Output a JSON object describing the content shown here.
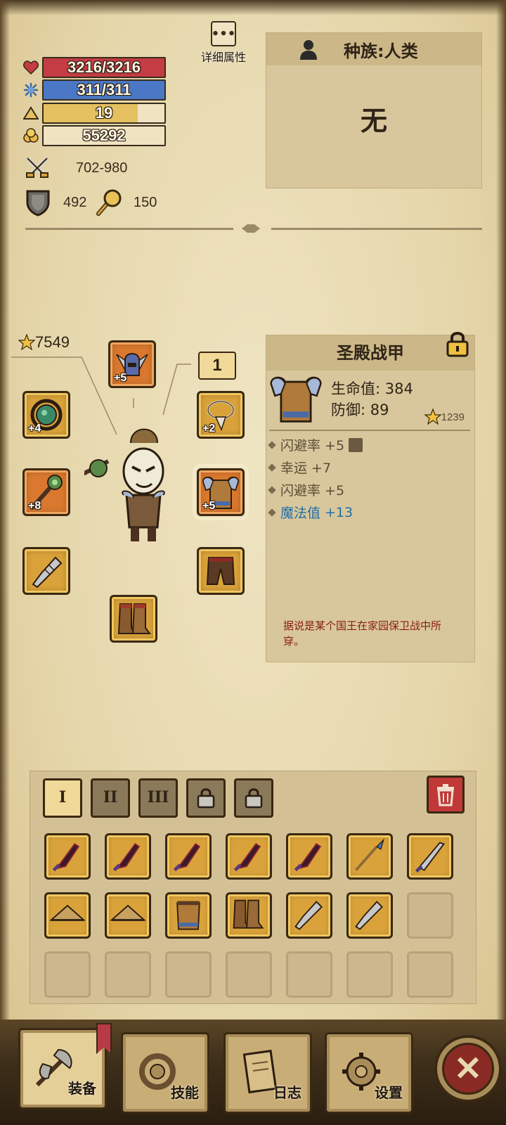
{
  "stats": {
    "hp": {
      "text": "3216/3216",
      "fill": 1.0,
      "color": "#c43c44"
    },
    "mp": {
      "text": "311/311",
      "fill": 1.0,
      "color": "#4a78c4"
    },
    "level": {
      "text": "19",
      "fill": 0.78,
      "color": "#e5c060"
    },
    "gold": {
      "text": "55292"
    },
    "attack": "702-980",
    "defense": "492",
    "luck": "150"
  },
  "detail_button_label": "详细属性",
  "race": {
    "label": "种族:人类",
    "value": "无"
  },
  "power": "7549",
  "set_button": "1",
  "equipment": [
    {
      "slot": "helmet",
      "plus": "+5",
      "icon": "winged-helmet-icon"
    },
    {
      "slot": "amulet",
      "plus": "+4",
      "icon": "jade-amulet-icon"
    },
    {
      "slot": "necklace",
      "plus": "+2",
      "icon": "fang-necklace-icon"
    },
    {
      "slot": "weapon",
      "plus": "+8",
      "icon": "thorn-staff-icon"
    },
    {
      "slot": "armor",
      "plus": "+5",
      "icon": "sanctuary-armor-icon"
    },
    {
      "slot": "gloves",
      "plus": "",
      "icon": "gauntlet-icon"
    },
    {
      "slot": "pants",
      "plus": "",
      "icon": "leather-pants-icon"
    },
    {
      "slot": "boots",
      "plus": "",
      "icon": "leather-boots-icon"
    }
  ],
  "item": {
    "name": "圣殿战甲",
    "hp_line": "生命值: 384",
    "def_line": "防御: 89",
    "score": "1239",
    "affixes": [
      {
        "text": "闪避率 +5",
        "blue": false,
        "has_icon": true
      },
      {
        "text": "幸运 +7",
        "blue": false,
        "has_icon": false
      },
      {
        "text": "闪避率 +5",
        "blue": false,
        "has_icon": false
      },
      {
        "label": "魔法值",
        "value": "+13",
        "blue": true,
        "has_icon": false
      }
    ],
    "lore": "据说是某个国王在家园保卫战中所穿。"
  },
  "inventory": {
    "tabs": [
      {
        "label": "I",
        "active": true,
        "locked": false
      },
      {
        "label": "II",
        "active": false,
        "locked": false
      },
      {
        "label": "III",
        "active": false,
        "locked": false
      },
      {
        "label": "",
        "active": false,
        "locked": true
      },
      {
        "label": "",
        "active": false,
        "locked": true
      }
    ],
    "row1": [
      "dark-blade-icon",
      "dark-blade-icon",
      "dark-blade-icon",
      "dark-blade-icon",
      "dark-blade-icon",
      "blue-spear-icon",
      "steel-dagger-icon"
    ],
    "row2": [
      "straw-hat-icon",
      "straw-hat-icon",
      "fur-vest-icon",
      "leather-boots-icon",
      "gauntlet-icon",
      "gauntlet-icon",
      "empty"
    ],
    "row3": [
      "empty",
      "empty",
      "empty",
      "empty",
      "empty",
      "empty",
      "empty"
    ]
  },
  "nav": [
    {
      "label": "装备",
      "active": true
    },
    {
      "label": "技能",
      "active": false
    },
    {
      "label": "日志",
      "active": false
    },
    {
      "label": "设置",
      "active": false
    }
  ]
}
